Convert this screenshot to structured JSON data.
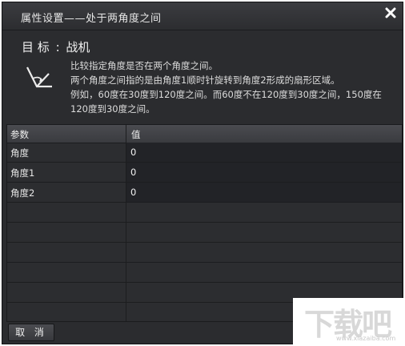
{
  "window": {
    "title": "属性设置——处于两角度之间"
  },
  "target": {
    "label": "目 标",
    "sep": ":",
    "value": "战机"
  },
  "description": {
    "icon": "angle-icon",
    "lines": [
      "比较指定角度是否在两个角度之间。",
      "两个角度之间指的是由角度1顺时针旋转到角度2形成的扇形区域。",
      "例如，60度在30度到120度之间。而60度不在120度到30度之间，150度在",
      "120度到30度之间。"
    ]
  },
  "grid": {
    "headers": {
      "param": "参数",
      "value": "值"
    },
    "rows": [
      {
        "name": "角度",
        "value": "0"
      },
      {
        "name": "角度1",
        "value": "0"
      },
      {
        "name": "角度2",
        "value": "0"
      }
    ]
  },
  "buttons": {
    "cancel": "取 消"
  },
  "watermark": {
    "main": "下载吧",
    "sub": "www.xiazaiba.com"
  },
  "colors": {
    "background": "#2b2c2f",
    "header": "#3a3b3f",
    "value_cell": "#222327"
  }
}
